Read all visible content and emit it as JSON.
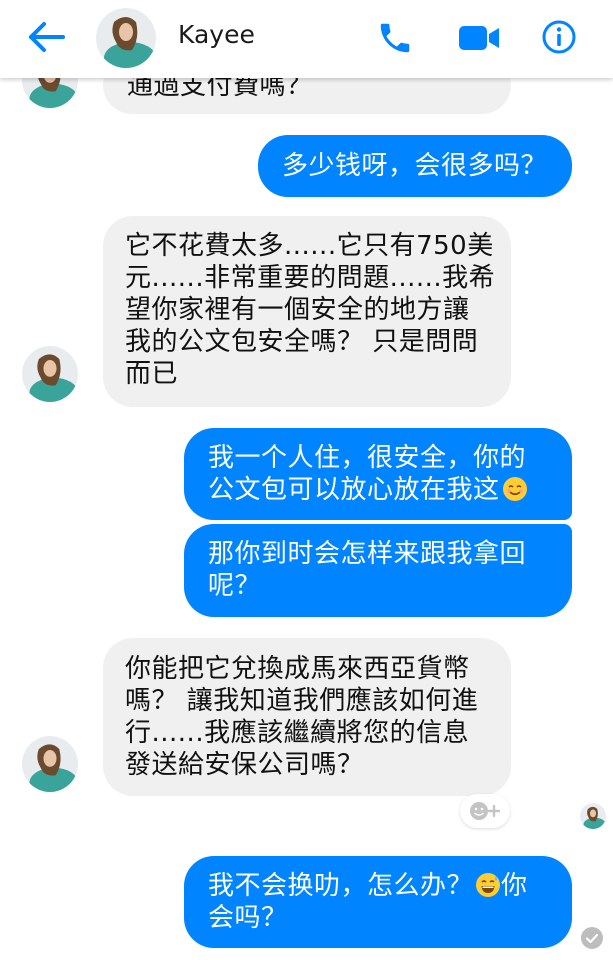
{
  "header": {
    "contact_name": "Kayee",
    "back_icon": "arrow-left-icon",
    "call_icon": "phone-icon",
    "video_icon": "video-camera-icon",
    "info_icon": "info-icon",
    "accent_color": "#0084ff"
  },
  "messages": [
    {
      "from": "them",
      "lines": [
        "通過支付費嗎？"
      ]
    },
    {
      "from": "me",
      "lines": [
        "多少钱呀，会很多吗？"
      ]
    },
    {
      "from": "them",
      "lines": [
        "它不花費太多......它只有750美",
        "元......非常重要的問題......我希",
        "望你家裡有一個安全的地方讓",
        "我的公文包安全嗎？ 只是問問",
        "而已"
      ]
    },
    {
      "from": "me",
      "lines": [
        "我一个人住，很安全，你的",
        "公文包可以放心放在我这"
      ],
      "emoji": "smiling-face-emoji"
    },
    {
      "from": "me",
      "lines": [
        "那你到时会怎样来跟我拿回",
        "呢？"
      ]
    },
    {
      "from": "them",
      "lines": [
        "你能把它兌換成馬來西亞貨幣",
        "嗎？ 讓我知道我們應該如何進",
        "行......我應該繼續將您的信息",
        "發送給安保公司嗎？"
      ]
    },
    {
      "from": "me",
      "lines": [
        "我不会换叻，怎么办？",
        "会吗？"
      ],
      "emoji": "grinning-sweat-emoji",
      "emoji_after": "你"
    }
  ],
  "reaction_button_icon": "add-reaction-icon",
  "status_icon": "delivered-check-icon",
  "colors": {
    "outgoing_bubble": "#0084ff",
    "incoming_bubble": "#f1f0f0"
  }
}
